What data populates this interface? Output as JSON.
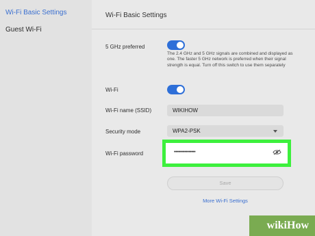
{
  "sidebar": {
    "items": [
      {
        "label": "Wi-Fi Basic Settings",
        "active": true
      },
      {
        "label": "Guest Wi-Fi",
        "active": false
      }
    ]
  },
  "main": {
    "title": "Wi-Fi Basic Settings",
    "ghz_preferred": {
      "label": "5 GHz preferred",
      "enabled": true,
      "description": "The 2.4 GHz and 5 GHz signals are combined and displayed as one. The faster 5 GHz network is preferred when their signal strength is equal. Turn off this switch to use them separately"
    },
    "wifi": {
      "label": "Wi-Fi",
      "enabled": true
    },
    "ssid": {
      "label": "Wi-Fi name (SSID)",
      "value": "WIKIHOW"
    },
    "security": {
      "label": "Security mode",
      "value": "WPA2-PSK"
    },
    "password": {
      "label": "Wi-Fi password",
      "value": "••••••••••••••••"
    },
    "save_label": "Save",
    "more_link": "More Wi-Fi Settings"
  },
  "watermark": {
    "brand": "wikiHow"
  },
  "colors": {
    "accent": "#2e6fd8",
    "link": "#3a6fd0",
    "highlight": "#3df03d",
    "watermark": "#7aab51"
  }
}
